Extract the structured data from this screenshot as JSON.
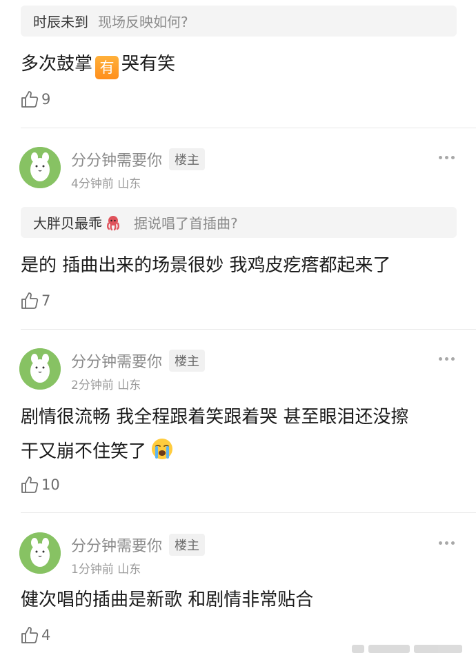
{
  "thread": {
    "top_reply": {
      "quote_author": "时辰未到",
      "quote_text": "现场反映如何?",
      "text_before": "多次鼓掌",
      "badge": "有",
      "text_after": "哭有笑",
      "likes": "9"
    },
    "replies": [
      {
        "username": "分分钟需要你",
        "tag": "楼主",
        "time": "4分钟前",
        "location": "山东",
        "quote_author": "大胖贝最乖",
        "quote_text": "据说唱了首插曲?",
        "text": "是的 插曲出来的场景很妙 我鸡皮疙瘩都起来了",
        "likes": "7"
      },
      {
        "username": "分分钟需要你",
        "tag": "楼主",
        "time": "2分钟前",
        "location": "山东",
        "text_line1": "剧情很流畅 我全程跟着笑跟着哭 甚至眼泪还没擦",
        "text_line2": "干又崩不住笑了",
        "likes": "10"
      },
      {
        "username": "分分钟需要你",
        "tag": "楼主",
        "time": "1分钟前",
        "location": "山东",
        "text": "健次唱的插曲是新歌 和剧情非常贴合",
        "likes": "4"
      }
    ]
  },
  "icons": {
    "like": "thumbs-up-icon",
    "more": "more-dots-icon",
    "avatar": "white-cat-avatar",
    "emoji_octopus": "octopus-emoji",
    "emoji_crying": "loudly-crying-face-emoji"
  },
  "colors": {
    "badge": "#ff9a26",
    "avatar_bg": "#87c263",
    "meta": "#9a9a9a"
  }
}
